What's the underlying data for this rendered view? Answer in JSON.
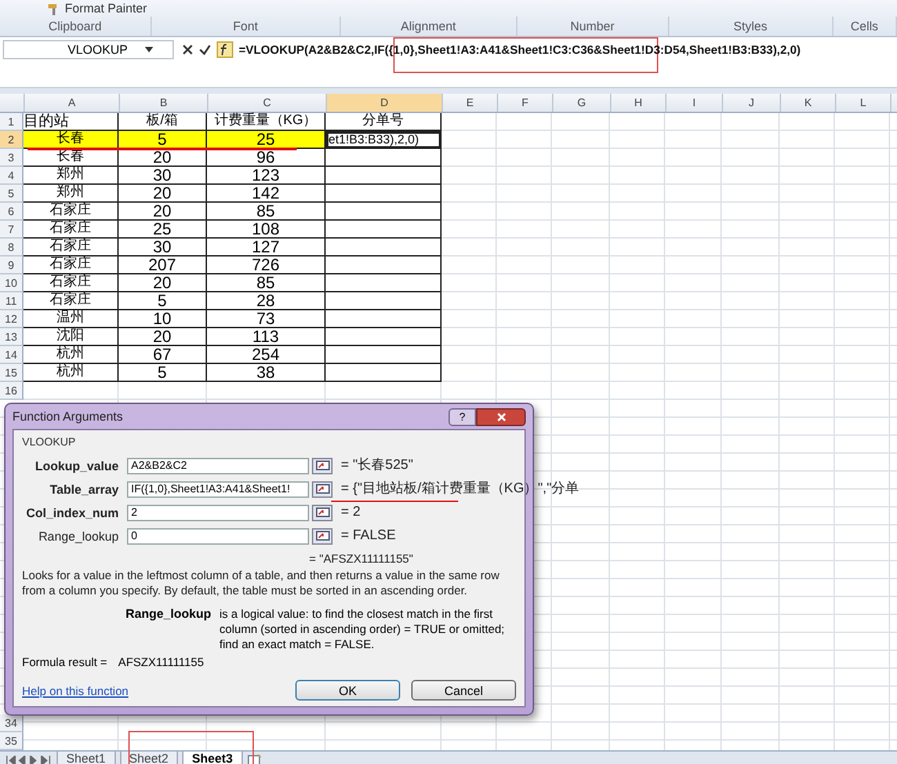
{
  "ribbon": {
    "format_painter": "Format Painter",
    "groups": [
      "Clipboard",
      "Font",
      "Alignment",
      "Number",
      "Styles",
      "Cells"
    ]
  },
  "formula_bar": {
    "name_box": "VLOOKUP",
    "formula": "=VLOOKUP(A2&B2&C2,IF({1,0},Sheet1!A3:A41&Sheet1!C3:C36&Sheet1!D3:D54,Sheet1!B3:B33),2,0)"
  },
  "spreadsheet": {
    "columns": [
      "A",
      "B",
      "C",
      "D",
      "E",
      "F",
      "G",
      "H",
      "I",
      "J",
      "K",
      "L"
    ],
    "rows": [
      {
        "number": "1",
        "cells": [
          "目的站",
          "板/箱",
          "计费重量（KG）",
          "分单号"
        ],
        "highlighted": false,
        "editing": false
      },
      {
        "number": "2",
        "cells": [
          "长春",
          "5",
          "25",
          "et1!B3:B33),2,0)"
        ],
        "highlighted": true,
        "editing": true
      },
      {
        "number": "3",
        "cells": [
          "长春",
          "20",
          "96"
        ],
        "highlighted": false,
        "editing": false
      },
      {
        "number": "4",
        "cells": [
          "郑州",
          "30",
          "123"
        ],
        "highlighted": false,
        "editing": false
      },
      {
        "number": "5",
        "cells": [
          "郑州",
          "20",
          "142"
        ],
        "highlighted": false,
        "editing": false
      },
      {
        "number": "6",
        "cells": [
          "石家庄",
          "20",
          "85"
        ],
        "highlighted": false,
        "editing": false
      },
      {
        "number": "7",
        "cells": [
          "石家庄",
          "25",
          "108"
        ],
        "highlighted": false,
        "editing": false
      },
      {
        "number": "8",
        "cells": [
          "石家庄",
          "30",
          "127"
        ],
        "highlighted": false,
        "editing": false
      },
      {
        "number": "9",
        "cells": [
          "石家庄",
          "207",
          "726"
        ],
        "highlighted": false,
        "editing": false
      },
      {
        "number": "10",
        "cells": [
          "石家庄",
          "20",
          "85"
        ],
        "highlighted": false,
        "editing": false
      },
      {
        "number": "11",
        "cells": [
          "石家庄",
          "5",
          "28"
        ],
        "highlighted": false,
        "editing": false
      },
      {
        "number": "12",
        "cells": [
          "温州",
          "10",
          "73"
        ],
        "highlighted": false,
        "editing": false
      },
      {
        "number": "13",
        "cells": [
          "沈阳",
          "20",
          "113"
        ],
        "highlighted": false,
        "editing": false
      },
      {
        "number": "14",
        "cells": [
          "杭州",
          "67",
          "254"
        ],
        "highlighted": false,
        "editing": false
      },
      {
        "number": "15",
        "cells": [
          "杭州",
          "5",
          "38"
        ],
        "highlighted": false,
        "editing": false
      },
      {
        "number": "16",
        "highlighted": false,
        "editing": false
      }
    ],
    "rows_below": [
      {
        "number": "34"
      },
      {
        "number": "35"
      }
    ]
  },
  "dialog": {
    "title": "Function Arguments",
    "help": "?",
    "function_name": "VLOOKUP",
    "arguments": [
      {
        "label": "Lookup_value",
        "value": "A2&B2&C2",
        "result": "= \"长春525\"",
        "required": true
      },
      {
        "label": "Table_array",
        "value": "IF({1,0},Sheet1!A3:A41&Sheet1!",
        "result": "= {\"目地站板/箱计费重量（KG）\",\"分单",
        "required": true
      },
      {
        "label": "Col_index_num",
        "value": "2",
        "result": "= 2",
        "required": true
      },
      {
        "label": "Range_lookup",
        "value": "0",
        "result": "= FALSE",
        "required": false
      }
    ],
    "overall_result": "= \"AFSZX11111155\"",
    "description": "Looks for a value in the leftmost column of a table, and then returns a value in the same row from a column you specify. By default, the table must be sorted in an ascending order.",
    "argument_name": "Range_lookup",
    "argument_help": "is a logical value: to find the closest match in the first column (sorted in ascending order) = TRUE or omitted; find an exact match = FALSE.",
    "formula_result_label": "Formula result =",
    "formula_result": "AFSZX11111155",
    "help_link": "Help on this function",
    "buttons": [
      "OK",
      "Cancel"
    ]
  },
  "sheet_tabs": [
    {
      "label": "Sheet1",
      "selected": false
    },
    {
      "label": "Sheet2",
      "selected": false
    },
    {
      "label": "Sheet3",
      "selected": true
    }
  ]
}
